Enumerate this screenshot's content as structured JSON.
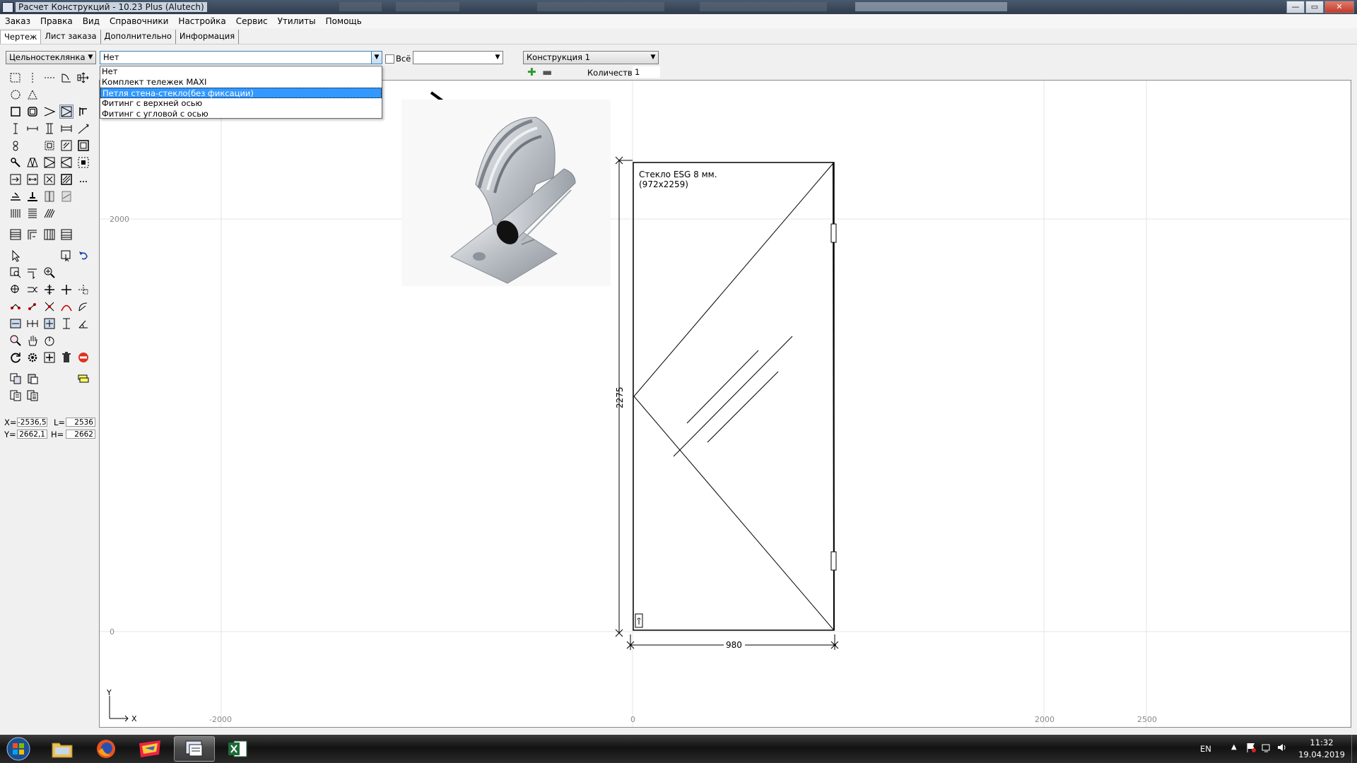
{
  "window": {
    "title": "Расчет Конструкций - 10.23 Plus (Alutech)"
  },
  "window_controls": {
    "minimize": "—",
    "maximize": "▭",
    "close": "✕"
  },
  "menu": [
    "Заказ",
    "Правка",
    "Вид",
    "Справочники",
    "Настройка",
    "Сервис",
    "Утилиты",
    "Помощь"
  ],
  "tabs": [
    {
      "label": "Чертеж",
      "active": true
    },
    {
      "label": "Лист заказа",
      "active": false
    },
    {
      "label": "Дополнительно",
      "active": false
    },
    {
      "label": "Информация",
      "active": false
    }
  ],
  "toolbar": {
    "system_combo": "Цельностеклянка",
    "fitting_combo": "Нет",
    "all_label": "Всё",
    "all_checked": false,
    "secondary_combo": "",
    "construction_combo": "Конструкция 1",
    "quantity_label": "Количество",
    "quantity_value": "1"
  },
  "dropdown": {
    "options": [
      "Нет",
      "Комплект тележек MAXI",
      "Петля стена-стекло(без фиксации)",
      "Фитинг с верхней осью",
      "Фитинг с угловой с осью"
    ],
    "selected_index": 2
  },
  "coords": {
    "x_label": "X=",
    "x_value": "-2536,5",
    "l_label": "L=",
    "l_value": "2536",
    "y_label": "Y=",
    "y_value": "2662,1",
    "h_label": "H=",
    "h_value": "2662"
  },
  "drawing": {
    "glass_label_line1": "Стекло ESG 8 мм.",
    "glass_label_line2": "(972x2259)",
    "height_dim": "2275",
    "width_dim": "980",
    "axis_y_ticks": [
      "2000",
      "0"
    ],
    "axis_x_ticks": [
      "-2000",
      "0",
      "2000",
      "2500"
    ],
    "axis_x_name": "X",
    "axis_y_name": "Y"
  },
  "taskbar": {
    "lang": "EN",
    "time": "11:32",
    "date": "19.04.2019"
  }
}
